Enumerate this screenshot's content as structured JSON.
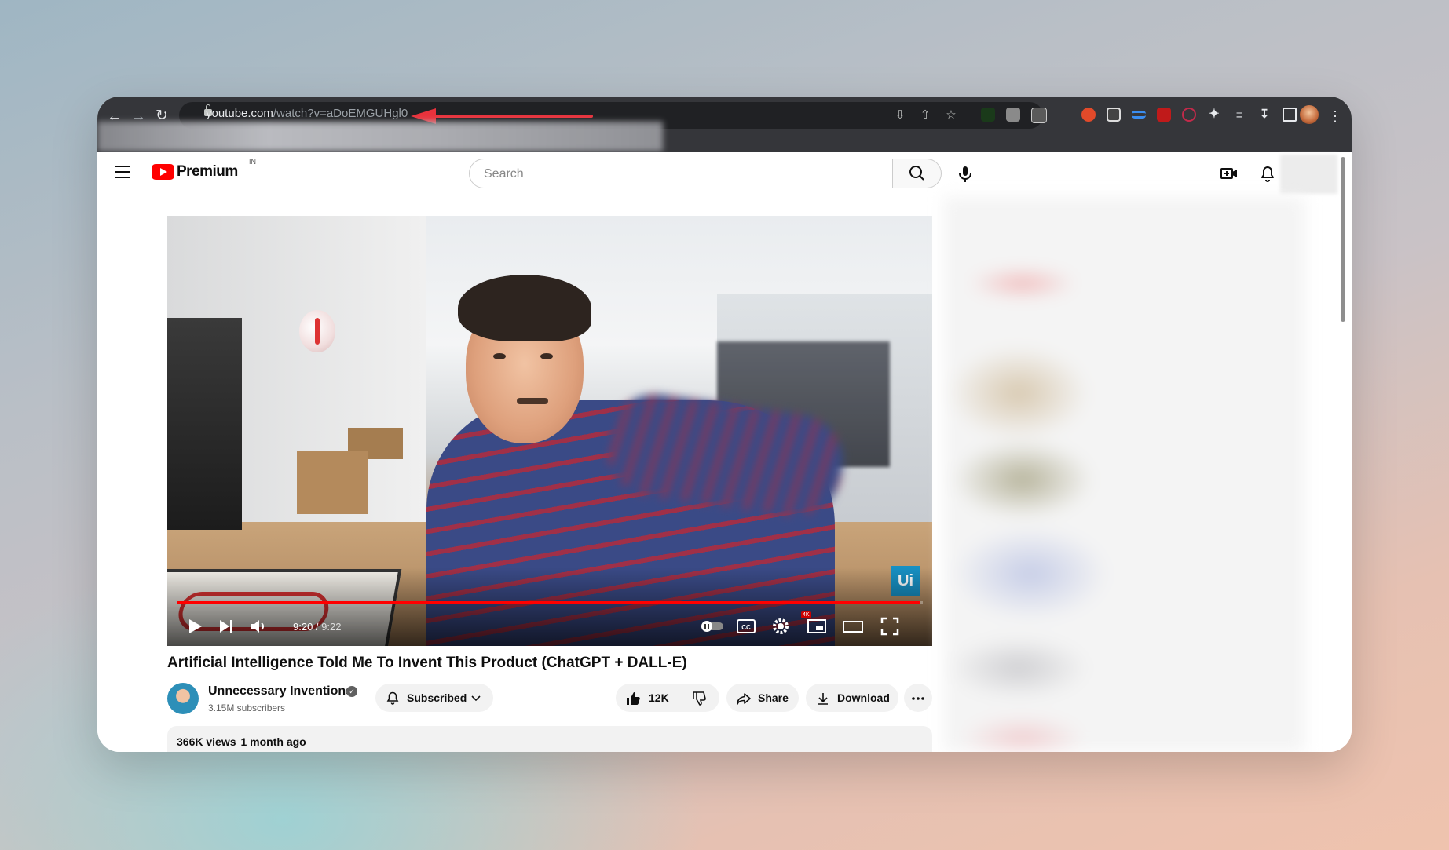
{
  "browser": {
    "url_host": "youtube.com",
    "url_path": "/watch?v=aDoEMGUHgl0"
  },
  "header": {
    "logo_text": "Premium",
    "logo_region": "IN",
    "search_placeholder": "Search"
  },
  "player": {
    "current_time": "9:20",
    "duration": "9:22",
    "progress_fraction": 0.996,
    "hd_badge": "4K",
    "watermark": "Ui"
  },
  "video": {
    "title": "Artificial Intelligence Told Me To Invent This Product (ChatGPT + DALL-E)",
    "channel_name": "Unnecessary Inventions",
    "channel_subscribers": "3.15M subscribers",
    "subscribe_label": "Subscribed",
    "like_count": "12K",
    "share_label": "Share",
    "download_label": "Download",
    "views": "366K views",
    "posted": "1 month ago"
  },
  "colors": {
    "brand_red": "#ff0000",
    "annotation_arrow": "#e8323c"
  }
}
